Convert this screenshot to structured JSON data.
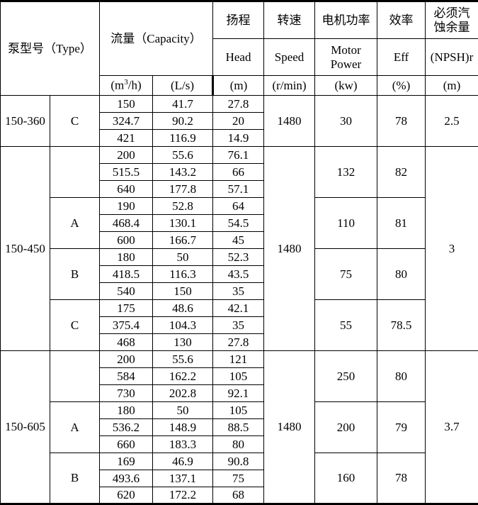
{
  "table": {
    "headers": {
      "type_cn": "泵型号（Type）",
      "capacity_cn": "流量（Capacity）",
      "capacity_unit_m3h": "(m3/h)",
      "capacity_unit_ls": "(L/s)",
      "head_cn": "扬程",
      "head_en": "Head",
      "head_unit": "(m)",
      "speed_cn": "转速",
      "speed_en": "Speed",
      "speed_unit": "(r/min)",
      "power_cn": "电机功率",
      "power_en_line1": "Motor",
      "power_en_line2": "Power",
      "power_unit": "(kw)",
      "eff_cn": "效率",
      "eff_en": "Eff",
      "eff_unit": "(%)",
      "npsh_cn_line1": "必须汽",
      "npsh_cn_line2": "蚀余量",
      "npsh_en": "(NPSH)r",
      "npsh_unit": "(m)"
    },
    "blocks": [
      {
        "model": "150-360",
        "speed": "1480",
        "npsh": "2.5",
        "subblocks": [
          {
            "type": "C",
            "power": "30",
            "eff": "78",
            "rows": [
              {
                "q_m3h": "150",
                "q_ls": "41.7",
                "head": "27.8"
              },
              {
                "q_m3h": "324.7",
                "q_ls": "90.2",
                "head": "20"
              },
              {
                "q_m3h": "421",
                "q_ls": "116.9",
                "head": "14.9"
              }
            ]
          }
        ]
      },
      {
        "model": "150-450",
        "speed": "1480",
        "npsh": "3",
        "subblocks": [
          {
            "type": "",
            "power": "132",
            "eff": "82",
            "rows": [
              {
                "q_m3h": "200",
                "q_ls": "55.6",
                "head": "76.1"
              },
              {
                "q_m3h": "515.5",
                "q_ls": "143.2",
                "head": "66"
              },
              {
                "q_m3h": "640",
                "q_ls": "177.8",
                "head": "57.1"
              }
            ]
          },
          {
            "type": "A",
            "power": "110",
            "eff": "81",
            "rows": [
              {
                "q_m3h": "190",
                "q_ls": "52.8",
                "head": "64"
              },
              {
                "q_m3h": "468.4",
                "q_ls": "130.1",
                "head": "54.5"
              },
              {
                "q_m3h": "600",
                "q_ls": "166.7",
                "head": "45"
              }
            ]
          },
          {
            "type": "B",
            "power": "75",
            "eff": "80",
            "rows": [
              {
                "q_m3h": "180",
                "q_ls": "50",
                "head": "52.3"
              },
              {
                "q_m3h": "418.5",
                "q_ls": "116.3",
                "head": "43.5"
              },
              {
                "q_m3h": "540",
                "q_ls": "150",
                "head": "35"
              }
            ]
          },
          {
            "type": "C",
            "power": "55",
            "eff": "78.5",
            "rows": [
              {
                "q_m3h": "175",
                "q_ls": "48.6",
                "head": "42.1"
              },
              {
                "q_m3h": "375.4",
                "q_ls": "104.3",
                "head": "35"
              },
              {
                "q_m3h": "468",
                "q_ls": "130",
                "head": "27.8"
              }
            ]
          }
        ]
      },
      {
        "model": "150-605",
        "speed": "1480",
        "npsh": "3.7",
        "subblocks": [
          {
            "type": "",
            "power": "250",
            "eff": "80",
            "rows": [
              {
                "q_m3h": "200",
                "q_ls": "55.6",
                "head": "121"
              },
              {
                "q_m3h": "584",
                "q_ls": "162.2",
                "head": "105"
              },
              {
                "q_m3h": "730",
                "q_ls": "202.8",
                "head": "92.1"
              }
            ]
          },
          {
            "type": "A",
            "power": "200",
            "eff": "79",
            "rows": [
              {
                "q_m3h": "180",
                "q_ls": "50",
                "head": "105"
              },
              {
                "q_m3h": "536.2",
                "q_ls": "148.9",
                "head": "88.5"
              },
              {
                "q_m3h": "660",
                "q_ls": "183.3",
                "head": "80"
              }
            ]
          },
          {
            "type": "B",
            "power": "160",
            "eff": "78",
            "rows": [
              {
                "q_m3h": "169",
                "q_ls": "46.9",
                "head": "90.8"
              },
              {
                "q_m3h": "493.6",
                "q_ls": "137.1",
                "head": "75"
              },
              {
                "q_m3h": "620",
                "q_ls": "172.2",
                "head": "68"
              }
            ]
          }
        ]
      }
    ]
  }
}
